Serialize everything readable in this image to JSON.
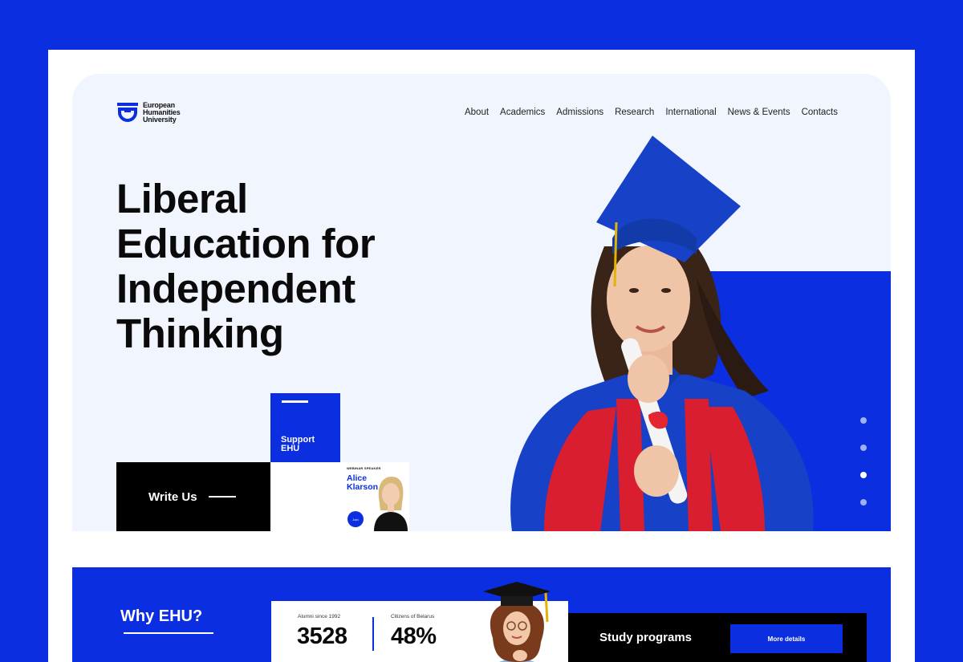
{
  "brand": {
    "name_lines": [
      "European",
      "Humanities",
      "University"
    ],
    "accent_color": "#0b2fe0"
  },
  "nav": {
    "items": [
      "About",
      "Academics",
      "Admissions",
      "Research",
      "International",
      "News & Events",
      "Contacts"
    ]
  },
  "hero": {
    "headline_lines": [
      "Liberal",
      "Education for",
      "Independent",
      "Thinking"
    ],
    "support_label": "Support EHU",
    "write_label": "Write Us",
    "speaker": {
      "tag": "WEBINAR SPEAKER",
      "name": "Alice Klarson",
      "join_label": "Join"
    },
    "slider": {
      "count": 4,
      "active_index": 3
    }
  },
  "why": {
    "title": "Why EHU?",
    "stats": [
      {
        "label": "Alumni since 1992",
        "value": "3528"
      },
      {
        "label": "Citizens of Belarus",
        "value": "48%"
      }
    ],
    "programs_label": "Study programs",
    "more_label": "More details"
  }
}
